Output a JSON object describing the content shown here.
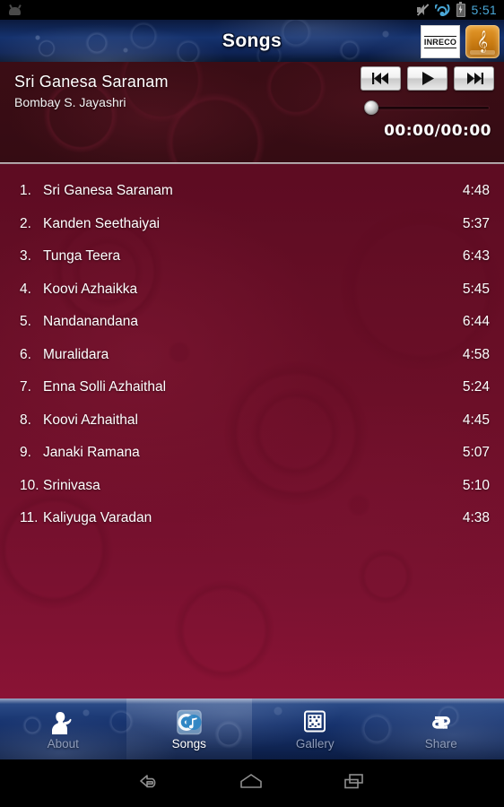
{
  "status_bar": {
    "notification_icon": "android-logo-icon",
    "mute_icon": "mute-icon",
    "wifi_icon": "wifi-icon",
    "battery_icon": "battery-charging-icon",
    "time": "5:51"
  },
  "header": {
    "title": "Songs",
    "logo_label": "INRECO",
    "logo_music_icon": "treble-clef-icon"
  },
  "player": {
    "track_title": "Sri Ganesa Saranam",
    "artist": "Bombay S. Jayashri",
    "previous_icon": "previous-track-icon",
    "play_icon": "play-icon",
    "next_icon": "next-track-icon",
    "seek_position_percent": 0,
    "timecode": "00:00/00:00"
  },
  "songs": [
    {
      "num": "1.",
      "title": "Sri Ganesa Saranam",
      "duration": "4:48"
    },
    {
      "num": "2.",
      "title": "Kanden Seethaiyai",
      "duration": "5:37"
    },
    {
      "num": "3.",
      "title": "Tunga Teera",
      "duration": "6:43"
    },
    {
      "num": "4.",
      "title": "Koovi Azhaikka",
      "duration": "5:45"
    },
    {
      "num": "5.",
      "title": "Nandanandana",
      "duration": "6:44"
    },
    {
      "num": "6.",
      "title": "Muralidara",
      "duration": "4:58"
    },
    {
      "num": "7.",
      "title": "Enna Solli Azhaithal",
      "duration": "5:24"
    },
    {
      "num": "8.",
      "title": "Koovi Azhaithal",
      "duration": "4:45"
    },
    {
      "num": "9.",
      "title": "Janaki Ramana",
      "duration": "5:07"
    },
    {
      "num": "10.",
      "title": "Srinivasa",
      "duration": "5:10"
    },
    {
      "num": "11.",
      "title": "Kaliyuga Varadan",
      "duration": "4:38"
    }
  ],
  "tabs": [
    {
      "label": "About",
      "icon": "singer-silhouette-icon",
      "selected": false
    },
    {
      "label": "Songs",
      "icon": "music-disc-icon",
      "selected": true
    },
    {
      "label": "Gallery",
      "icon": "photo-grid-icon",
      "selected": false
    },
    {
      "label": "Share",
      "icon": "share-arrows-icon",
      "selected": false
    }
  ],
  "nav_bar": {
    "back_icon": "back-arrow-icon",
    "home_icon": "home-icon",
    "recents_icon": "recent-apps-icon"
  },
  "colors": {
    "header_blue": "#15326e",
    "body_maroon": "#6c0f28",
    "player_maroon": "#3b0d15",
    "accent_gold": "#c97b12",
    "status_time_blue": "#4aa8d8"
  }
}
